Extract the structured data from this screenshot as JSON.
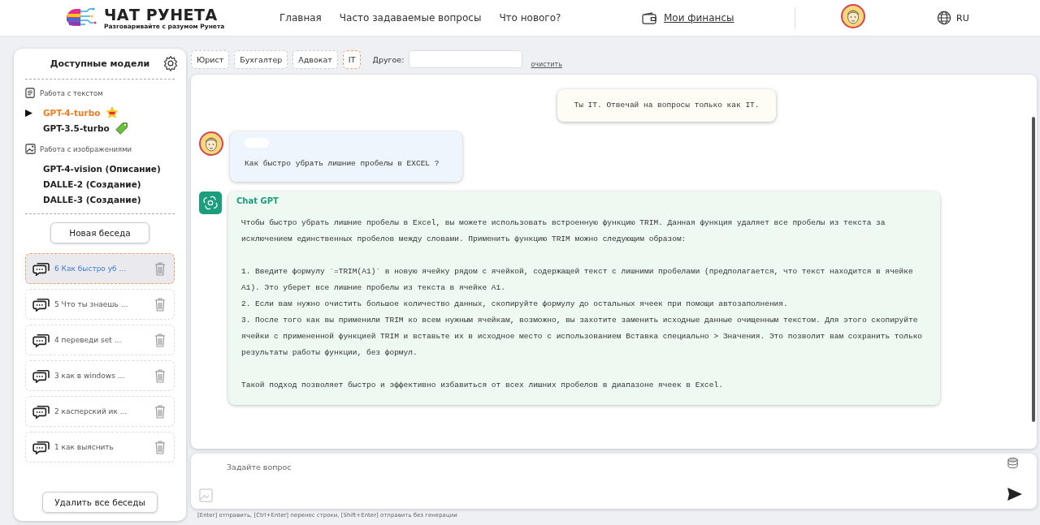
{
  "header": {
    "logo": {
      "title": "ЧАТ РУНЕТА",
      "subtitle": "Разговаривайте с разумом Рунета"
    },
    "nav": [
      "Главная",
      "Часто задаваемые вопросы",
      "Что нового?"
    ],
    "finance_link": "Мои финансы",
    "language": "RU"
  },
  "sidebar": {
    "title": "Доступные модели",
    "groups": [
      {
        "kind": "text",
        "label": "Работа с текстом",
        "models": [
          {
            "name": "GPT-4-turbo",
            "selected": true,
            "kind": "top"
          },
          {
            "name": "GPT-3.5-turbo",
            "selected": false,
            "kind": "free"
          }
        ]
      },
      {
        "kind": "image",
        "label": "Работа с изображениями",
        "models": [
          {
            "name": "GPT-4-vision (Описание)",
            "selected": false
          },
          {
            "name": "DALLE-2 (Создание)",
            "selected": false
          },
          {
            "name": "DALLE-3 (Создание)",
            "selected": false
          }
        ]
      }
    ],
    "new_chat_button": "Новая беседа",
    "chats": [
      {
        "number": "6",
        "title": "Как быстро уб ...",
        "selected": true
      },
      {
        "number": "5",
        "title": "Что ты знаешь ...",
        "selected": false
      },
      {
        "number": "4",
        "title": "переведи set ...",
        "selected": false
      },
      {
        "number": "3",
        "title": "как в windows ...",
        "selected": false
      },
      {
        "number": "2",
        "title": "касперский ик ...",
        "selected": false
      },
      {
        "number": "1",
        "title": "как выяснить",
        "selected": false
      }
    ],
    "delete_all_button": "Удалить все беседы"
  },
  "roles": {
    "items": [
      {
        "label": "Юрист",
        "selected": false
      },
      {
        "label": "Бухгалтер",
        "selected": false
      },
      {
        "label": "Адвокат",
        "selected": false
      },
      {
        "label": "IT",
        "selected": true
      }
    ],
    "other_label": "Другое:",
    "clear_link": "очистить"
  },
  "chat": {
    "messages": [
      {
        "kind": "system",
        "paragraphs": [
          "Ты IT. Отвечай на вопросы только как IT."
        ]
      },
      {
        "kind": "user",
        "paragraphs": [
          "Как быстро убрать лишние пробелы в EXCEL ?"
        ]
      },
      {
        "kind": "assistant",
        "author": "Chat GPT",
        "sections": [
          [
            "Чтобы быстро убрать лишние пробелы в Excel, вы можете использовать встроенную функцию TRIM. Данная функция удаляет все пробелы из текста за исключением единственных пробелов между словами. Применить функцию TRIM можно следующим образом:"
          ],
          [
            "1. Введите формулу `=TRIM(A1)` в новую ячейку рядом с ячейкой, содержащей текст с лишними пробелами (предполагается, что текст находится в ячейке A1). Это уберет все лишние пробелы из текста в ячейке A1.",
            "2. Если вам нужно очистить большое количество данных, скопируйте формулу до остальных ячеек при помощи автозаполнения.",
            "3. После того как вы применили TRIM ко всем нужным ячейкам, возможно, вы захотите заменить исходные данные очищенным текстом. Для этого скопируйте ячейки с примененной функцией TRIM и вставьте их в исходное место с использованием Вставка специально > Значения. Это позволит вам сохранить только результаты работы функции, без формул."
          ],
          [
            "Такой подход позволяет быстро и эффективно избавиться от всех лишних пробелов в диапазоне ячеек в Excel."
          ]
        ]
      }
    ]
  },
  "composer": {
    "placeholder": "Задайте вопрос",
    "hint": "[Enter] отправить, [Ctrl+Enter] перенос строки, [Shift+Enter] отправить без генерации"
  }
}
